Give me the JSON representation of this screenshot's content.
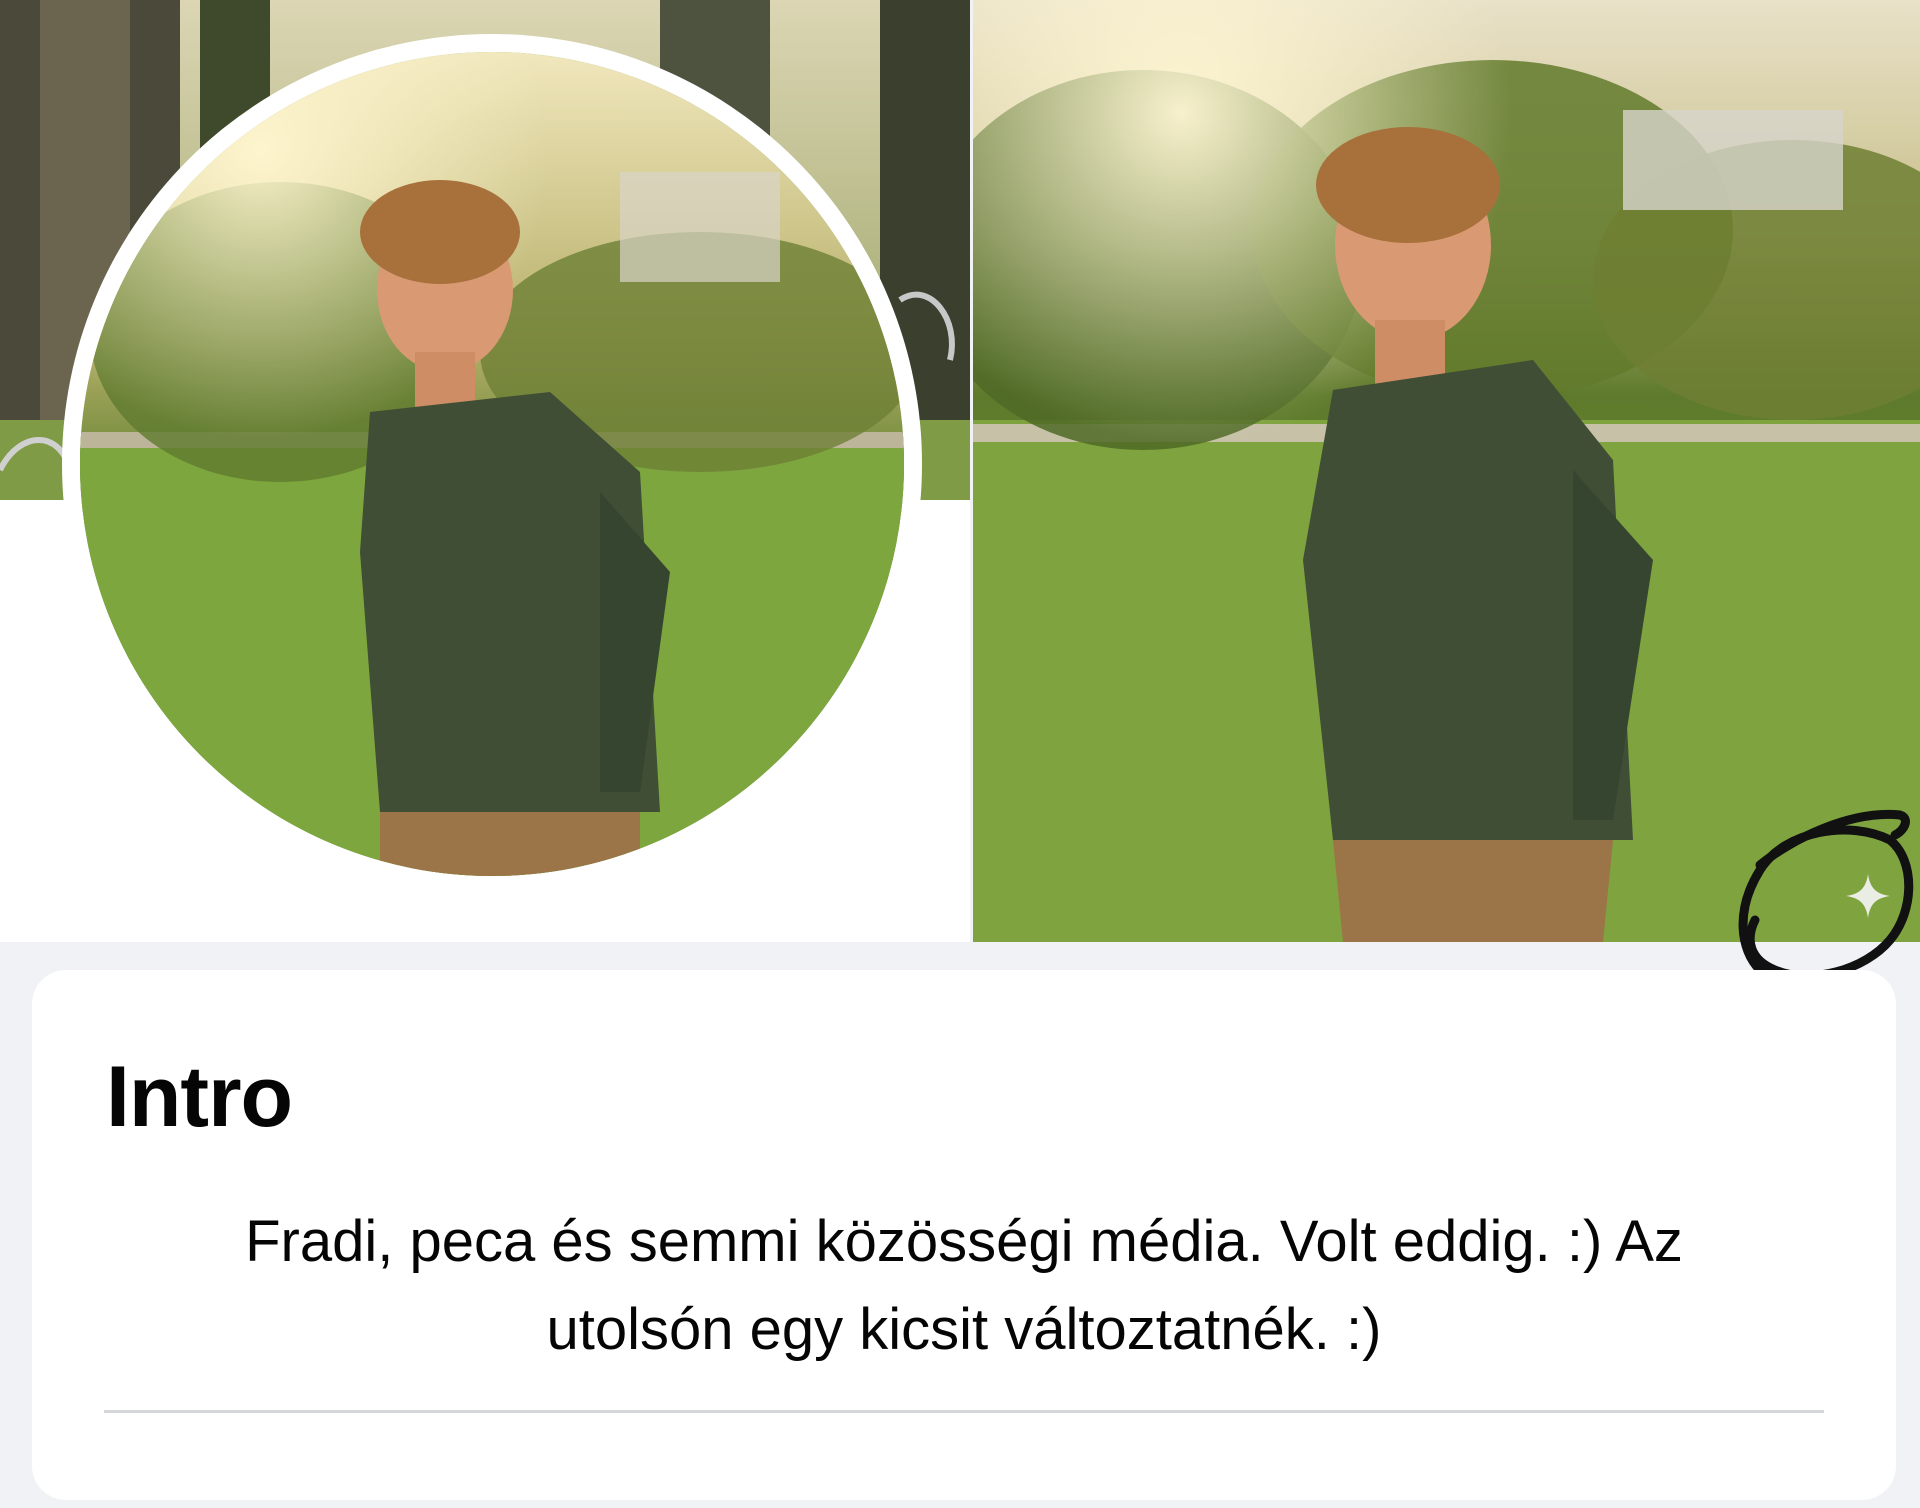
{
  "profile": {
    "cover_alt": "cover-photo",
    "avatar_alt": "profile-picture"
  },
  "preview": {
    "photo_alt": "full-size-profile-photo",
    "ai_icon": "sparkle-icon"
  },
  "intro": {
    "title": "Intro",
    "bio_line1": "Fradi, peca és semmi közösségi média. Volt eddig. :) Az",
    "bio_line2": "utolsón egy kicsit változtatnék. :)"
  },
  "colors": {
    "page_bg": "#f0f2f5",
    "card_bg": "#ffffff",
    "text": "#050505",
    "divider": "#d4d6da"
  }
}
